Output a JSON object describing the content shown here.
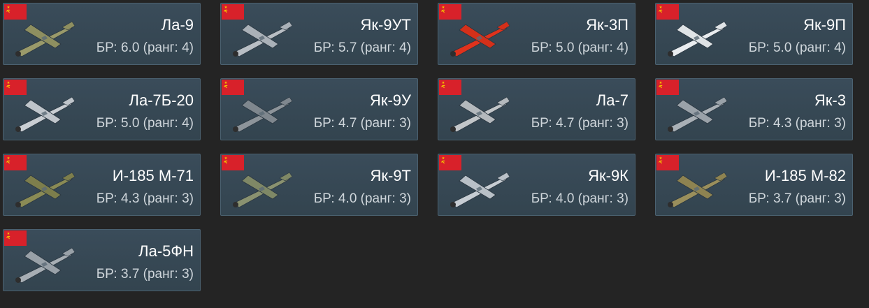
{
  "vehicles": [
    {
      "name": "Ла-9",
      "br": "БР: 6.0 (ранг: 4)",
      "country_flag_icon": "ussr-flag-icon",
      "colors": {
        "body": "#9a9a6a",
        "wing": "#8e8f60"
      }
    },
    {
      "name": "Як-9УТ",
      "br": "БР: 5.7 (ранг: 4)",
      "country_flag_icon": "ussr-flag-icon",
      "colors": {
        "body": "#b8bec4",
        "wing": "#aab1b8"
      }
    },
    {
      "name": "Як-3П",
      "br": "БР: 5.0 (ранг: 4)",
      "country_flag_icon": "ussr-flag-icon",
      "colors": {
        "body": "#e0321c",
        "wing": "#d4301a"
      }
    },
    {
      "name": "Як-9П",
      "br": "БР: 5.0 (ранг: 4)",
      "country_flag_icon": "ussr-flag-icon",
      "colors": {
        "body": "#e9ecef",
        "wing": "#dfe3e6"
      }
    },
    {
      "name": "Ла-7Б-20",
      "br": "БР: 5.0 (ранг: 4)",
      "country_flag_icon": "ussr-flag-icon",
      "colors": {
        "body": "#c9ced3",
        "wing": "#bfc5cb"
      }
    },
    {
      "name": "Як-9У",
      "br": "БР: 4.7 (ранг: 3)",
      "country_flag_icon": "ussr-flag-icon",
      "colors": {
        "body": "#8d949a",
        "wing": "#7f878e"
      }
    },
    {
      "name": "Ла-7",
      "br": "БР: 4.7 (ранг: 3)",
      "country_flag_icon": "ussr-flag-icon",
      "colors": {
        "body": "#c2c6c9",
        "wing": "#b4b9bd"
      }
    },
    {
      "name": "Як-3",
      "br": "БР: 4.3 (ранг: 3)",
      "country_flag_icon": "ussr-flag-icon",
      "colors": {
        "body": "#a9b0b6",
        "wing": "#9aa2a9"
      }
    },
    {
      "name": "И-185 М-71",
      "br": "БР: 4.3 (ранг: 3)",
      "country_flag_icon": "ussr-flag-icon",
      "colors": {
        "body": "#8a8b55",
        "wing": "#7d7e4c"
      }
    },
    {
      "name": "Як-9Т",
      "br": "БР: 4.0 (ранг: 3)",
      "country_flag_icon": "ussr-flag-icon",
      "colors": {
        "body": "#8a9270",
        "wing": "#7f8866"
      }
    },
    {
      "name": "Як-9К",
      "br": "БР: 4.0 (ранг: 3)",
      "country_flag_icon": "ussr-flag-icon",
      "colors": {
        "body": "#c7cdd3",
        "wing": "#b9c0c7"
      }
    },
    {
      "name": "И-185 М-82",
      "br": "БР: 3.7 (ранг: 3)",
      "country_flag_icon": "ussr-flag-icon",
      "colors": {
        "body": "#9a8f5c",
        "wing": "#8e8351"
      }
    },
    {
      "name": "Ла-5ФН",
      "br": "БР: 3.7 (ранг: 3)",
      "country_flag_icon": "ussr-flag-icon",
      "colors": {
        "body": "#a7aeb4",
        "wing": "#99a1a8"
      }
    }
  ],
  "theme": {
    "background": "#242424",
    "card": "#36474f",
    "card_border": "#4b6170",
    "flag_red": "#d8212a",
    "emblem_yellow": "#f3c300",
    "name_text": "#ffffff",
    "br_text": "#cfd6db"
  }
}
